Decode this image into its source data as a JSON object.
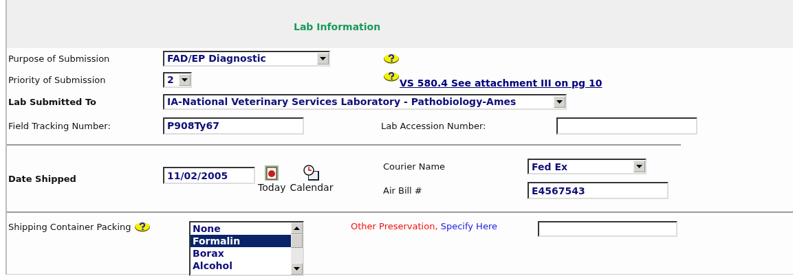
{
  "title": "Lab Information",
  "purpose": {
    "label": "Purpose of Submission",
    "value": "FAD/EP Diagnostic"
  },
  "priority": {
    "label": "Priority of Submission",
    "value": "2",
    "link": "VS 580.4 See attachment III on pg 10"
  },
  "lab": {
    "label": "Lab Submitted To",
    "value": "IA-National Veterinary Services Laboratory - Pathobiology-Ames"
  },
  "field_tracking": {
    "label": "Field Tracking Number:",
    "value": "P908Ty67"
  },
  "lab_accession": {
    "label": "Lab Accession Number:"
  },
  "date_shipped": {
    "label": "Date Shipped",
    "value": "11/02/2005",
    "buttons": [
      "Today",
      "Calendar"
    ]
  },
  "courier": {
    "label": "Courier Name",
    "value": "Fed Ex"
  },
  "air_bill": {
    "label": "Air Bill #",
    "value": "E4567543"
  },
  "packing": {
    "label": "Shipping Container Packing",
    "options": [
      {
        "label": "None",
        "selected": false
      },
      {
        "label": "Formalin",
        "selected": true
      },
      {
        "label": "Borax",
        "selected": false
      },
      {
        "label": "Alcohol",
        "selected": false
      }
    ]
  },
  "other_preservation": {
    "label": "Other Preservation,",
    "hint": "Specify Here"
  }
}
